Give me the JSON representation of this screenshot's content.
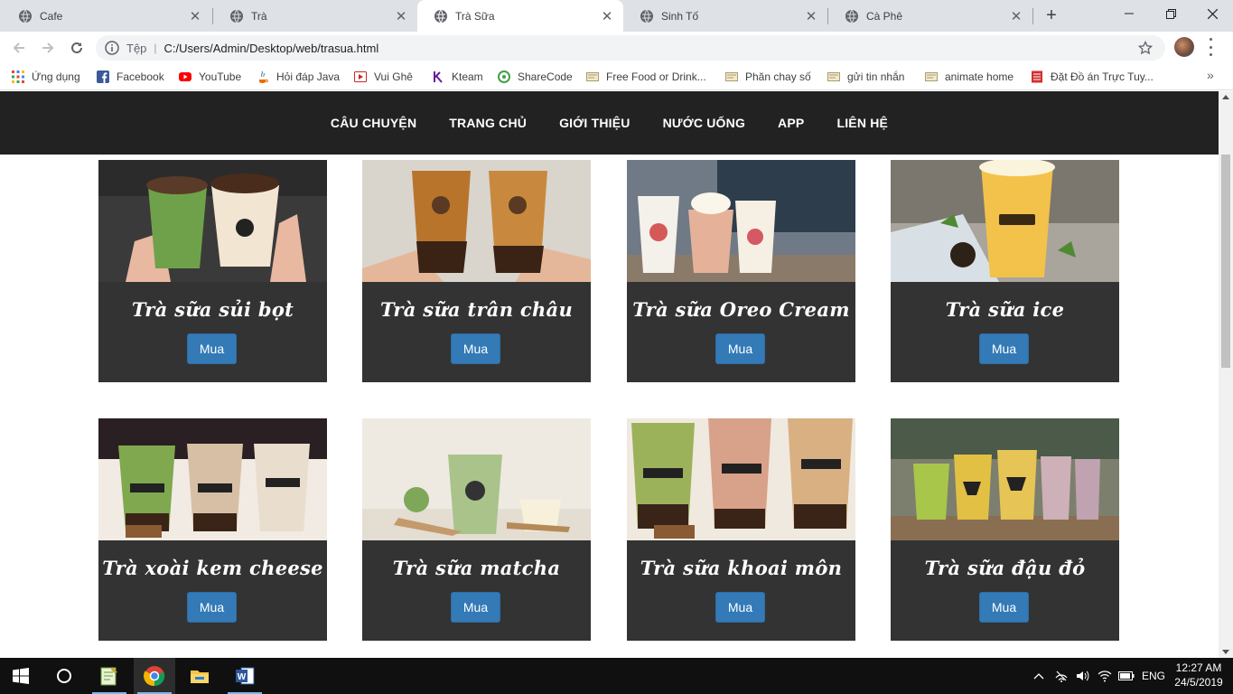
{
  "browser": {
    "tabs": [
      {
        "title": "Cafe"
      },
      {
        "title": "Trà"
      },
      {
        "title": "Trà Sữa"
      },
      {
        "title": "Sinh Tố"
      },
      {
        "title": "Cà Phê"
      }
    ],
    "new_tab": "+",
    "address": {
      "scheme_label": "Tệp",
      "url": "C:/Users/Admin/Desktop/web/trasua.html"
    },
    "bookmarks": [
      {
        "label": "Ứng dụng",
        "icon": "apps-grid-icon"
      },
      {
        "label": "Facebook",
        "icon": "facebook-icon"
      },
      {
        "label": "YouTube",
        "icon": "youtube-icon"
      },
      {
        "label": "Hỏi đáp Java",
        "icon": "java-icon"
      },
      {
        "label": "Vui Ghê",
        "icon": "play-icon"
      },
      {
        "label": "Kteam",
        "icon": "kteam-icon"
      },
      {
        "label": "ShareCode",
        "icon": "sharecode-icon"
      },
      {
        "label": "Free Food or Drink...",
        "icon": "page-icon"
      },
      {
        "label": "Phăn chay số",
        "icon": "page-icon"
      },
      {
        "label": "gửi tin nhắn",
        "icon": "page-icon"
      },
      {
        "label": "animate home",
        "icon": "page-icon"
      },
      {
        "label": "Đặt Đồ án Trực Tuy...",
        "icon": "bookmark-red-icon"
      }
    ],
    "more": "»"
  },
  "site": {
    "nav": [
      "CÂU CHUYỆN",
      "TRANG CHỦ",
      "GIỚI THIỆU",
      "NƯỚC UỐNG",
      "APP",
      "LIÊN HỆ"
    ],
    "products": [
      {
        "name": "Trà sữa sủi bọt",
        "button": "Mua"
      },
      {
        "name": "Trà sữa trân châu",
        "button": "Mua"
      },
      {
        "name": "Trà sữa Oreo Cream",
        "button": "Mua"
      },
      {
        "name": "Trà sữa ice",
        "button": "Mua"
      },
      {
        "name": "Trà xoài kem cheese",
        "button": "Mua"
      },
      {
        "name": "Trà sữa matcha",
        "button": "Mua"
      },
      {
        "name": "Trà sữa khoai môn",
        "button": "Mua"
      },
      {
        "name": "Trà sữa đậu đỏ",
        "button": "Mua"
      }
    ]
  },
  "taskbar": {
    "language": "ENG",
    "time": "12:27 AM",
    "date": "24/5/2019"
  },
  "colors": {
    "nav_bg": "#222222",
    "card_bg": "#333333",
    "button_bg": "#337ab7",
    "tab_bar": "#dee1e6"
  }
}
